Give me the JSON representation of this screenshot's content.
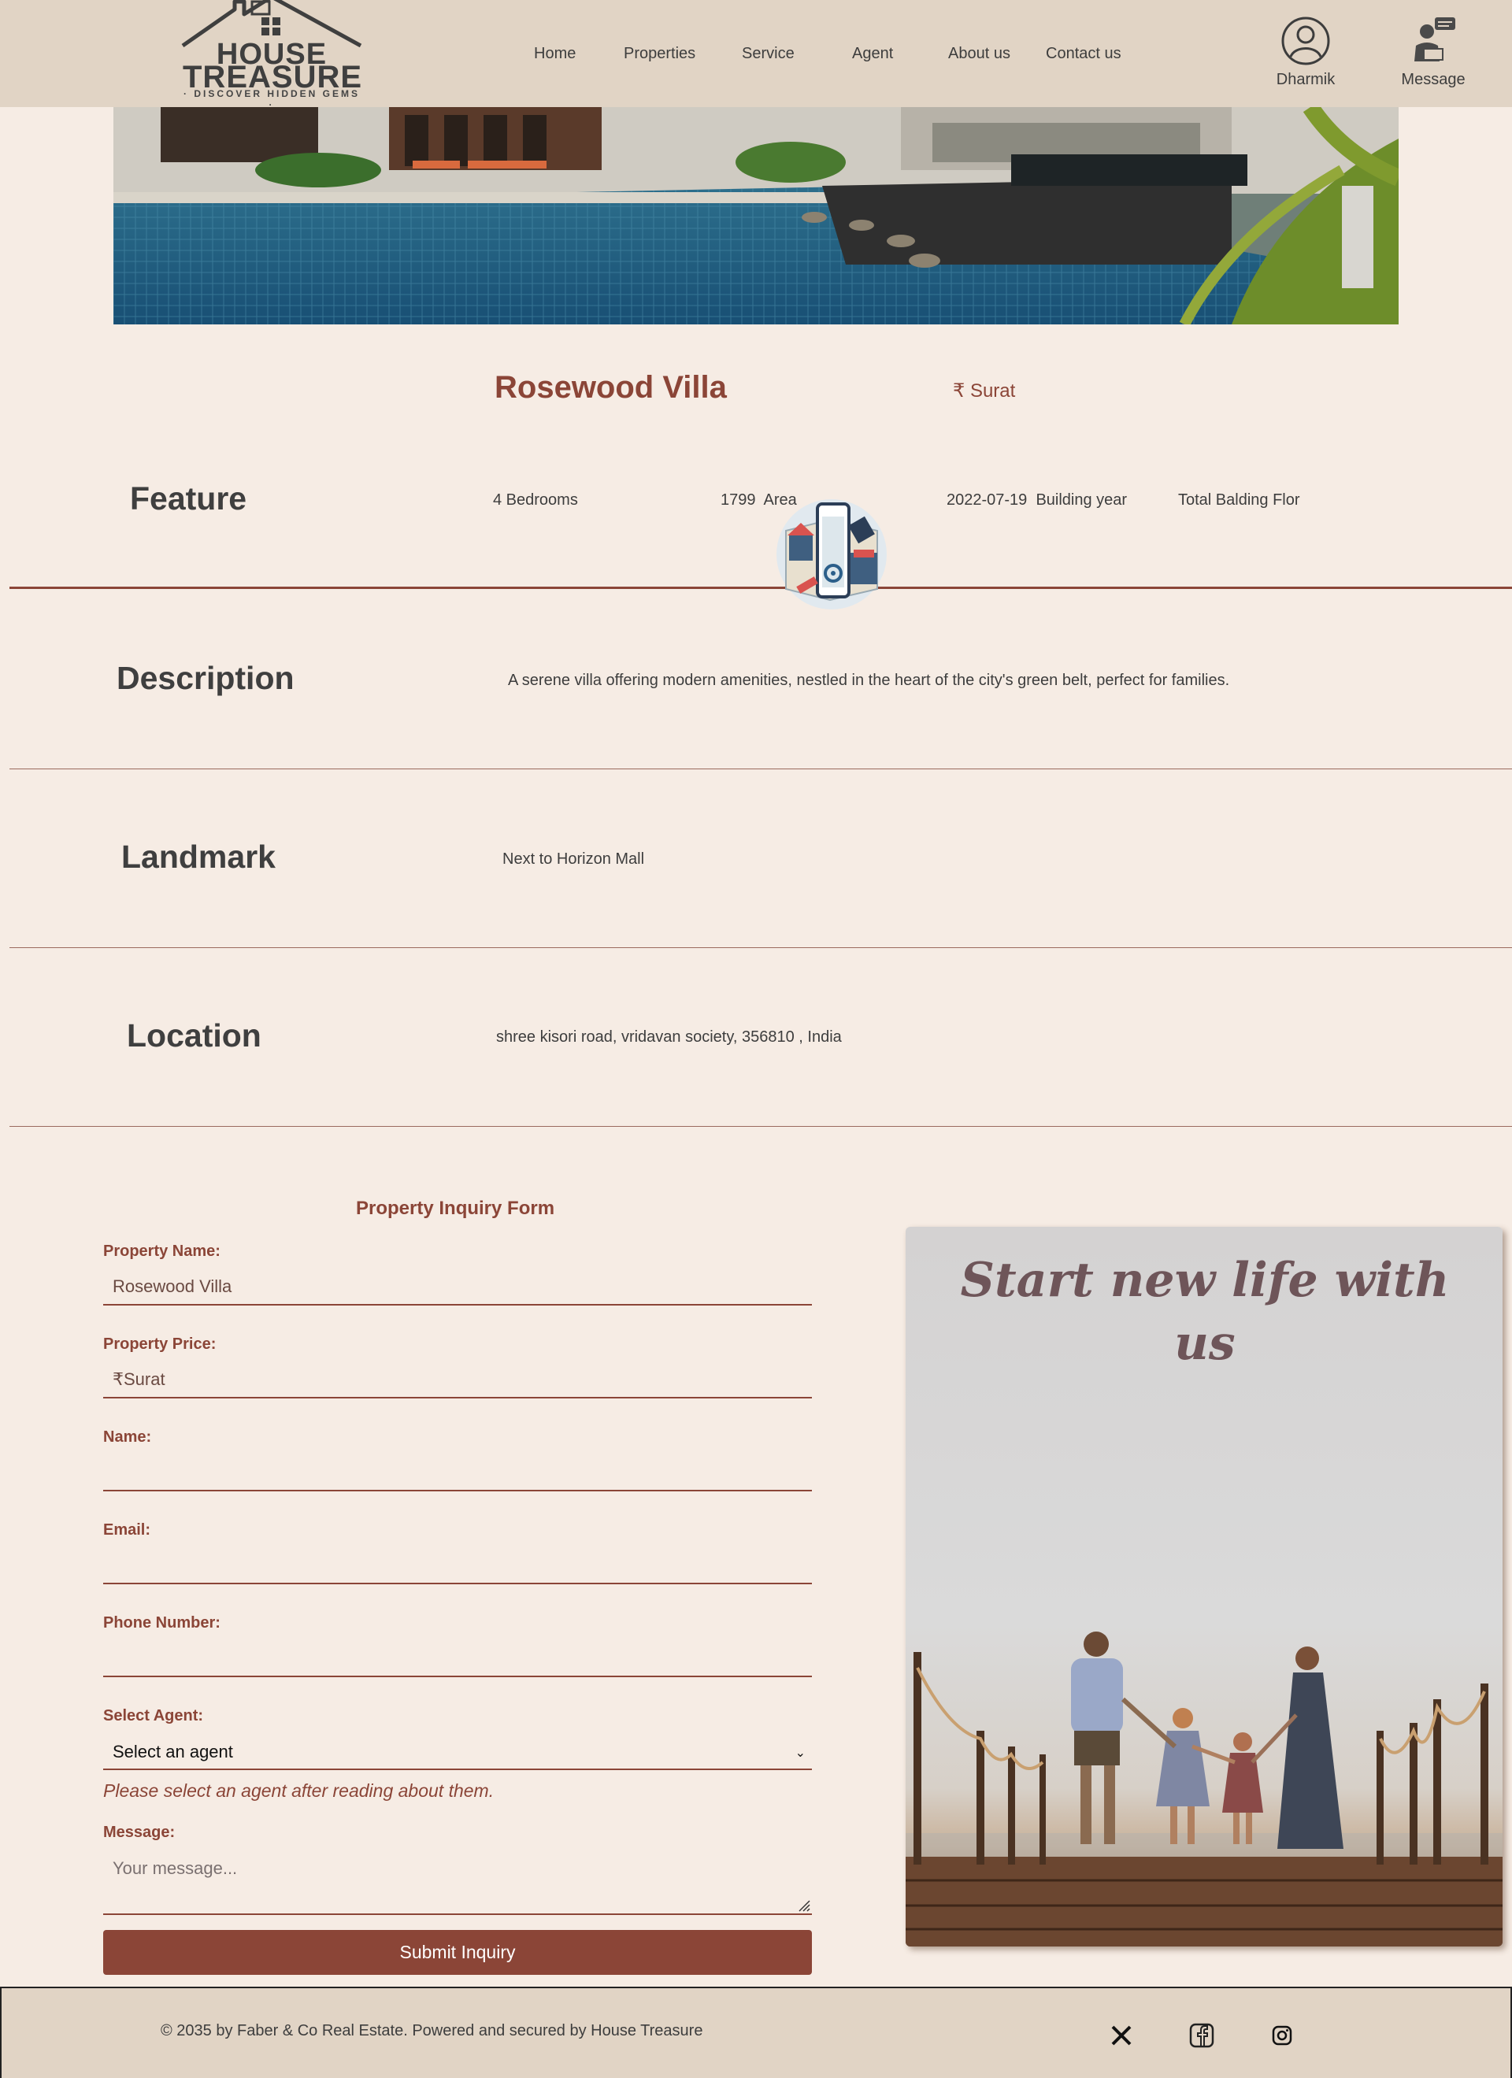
{
  "brand": {
    "line1": "HOUSE",
    "line2": "TREASURE",
    "tagline": "· DISCOVER HIDDEN GEMS ·"
  },
  "nav": {
    "home": "Home",
    "properties": "Properties",
    "service": "Service",
    "agent": "Agent",
    "about": "About us",
    "contact": "Contact us"
  },
  "user": {
    "name": "Dharmik",
    "icon": "user-circle-icon"
  },
  "messages": {
    "label": "Message",
    "icon": "agent-chat-icon"
  },
  "property": {
    "title": "Rosewood Villa",
    "price_symbol": "₹",
    "price_text": "Surat"
  },
  "feature": {
    "heading": "Feature",
    "bedrooms": "4 Bedrooms",
    "area_value": "1799",
    "area_label": "Area",
    "year_value": "2022-07-19",
    "year_label": "Building year",
    "floors_label": "Total Balding Flor"
  },
  "description": {
    "heading": "Description",
    "text": "A serene villa offering modern amenities, nestled in the heart of the city's green belt, perfect for families."
  },
  "landmark": {
    "heading": "Landmark",
    "text": "Next to Horizon Mall"
  },
  "location": {
    "heading": "Location",
    "text": "shree kisori road, vridavan society, 356810 , India"
  },
  "form": {
    "title": "Property Inquiry Form",
    "property_name_label": "Property Name:",
    "property_name_value": "Rosewood Villa",
    "property_price_label": "Property Price:",
    "property_price_value": "₹Surat",
    "name_label": "Name:",
    "name_value": "",
    "email_label": "Email:",
    "email_value": "",
    "phone_label": "Phone Number:",
    "phone_value": "",
    "agent_label": "Select Agent:",
    "agent_selected": "Select an agent",
    "agent_help": "Please select an agent after reading about them.",
    "message_label": "Message:",
    "message_placeholder": "Your message...",
    "submit_label": "Submit Inquiry"
  },
  "promo": {
    "text": "Start new life with us"
  },
  "footer": {
    "copyright": "© 2035 by Faber & Co Real Estate. Powered and secured by House Treasure",
    "social": [
      "x-icon",
      "facebook-icon",
      "instagram-icon"
    ]
  },
  "colors": {
    "accent": "#8b4537",
    "header_bg": "#e1d4c5",
    "page_bg": "#f6ece4",
    "text": "#3d3d3d"
  }
}
